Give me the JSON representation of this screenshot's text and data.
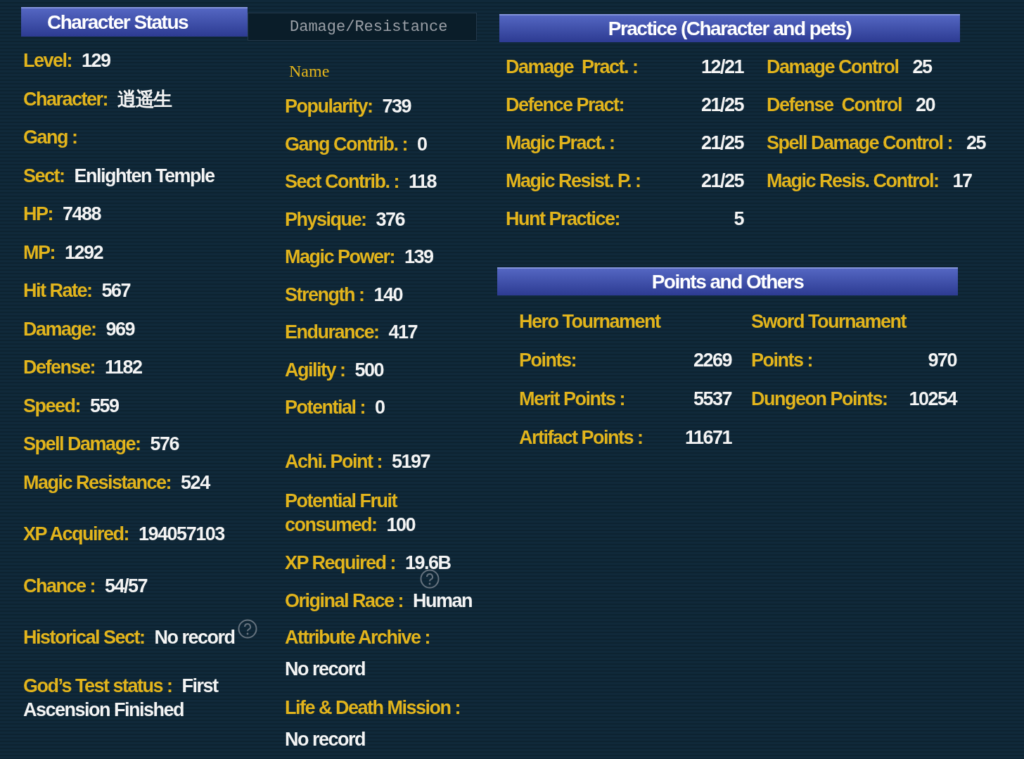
{
  "tabs": [
    {
      "label": "Character Status",
      "selected": true
    },
    {
      "label": "Damage/Resistance",
      "selected": false
    }
  ],
  "character_status": {
    "items": [
      {
        "label": "Level:",
        "value": "129",
        "kind": "inline",
        "help": false
      },
      {
        "label": "Character:",
        "value": "逍遥生",
        "kind": "inline",
        "help": false
      },
      {
        "label": "Gang :",
        "kind": "inline",
        "help": false
      },
      {
        "label": "Sect:",
        "value": "Enlighten Temple",
        "kind": "inline",
        "help": false
      },
      {
        "label": "HP:",
        "value": "7488",
        "kind": "inline",
        "help": false
      },
      {
        "label": "MP:",
        "value": "1292",
        "kind": "inline",
        "help": false
      },
      {
        "label": "Hit Rate:",
        "value": "567",
        "kind": "inline",
        "help": false
      },
      {
        "label": "Damage:",
        "value": "969",
        "kind": "inline",
        "help": false
      },
      {
        "label": "Defense:",
        "value": "1182",
        "kind": "inline",
        "help": false
      },
      {
        "label": "Speed:",
        "value": "559",
        "kind": "inline",
        "help": false
      },
      {
        "label": "Spell Damage:",
        "value": "576",
        "kind": "inline",
        "help": false
      },
      {
        "label": "Magic Resistance:",
        "value": "524",
        "kind": "inline",
        "help": false
      },
      {
        "label": "XP Acquired:",
        "value": "194057103",
        "kind": "inline",
        "help": false
      },
      {
        "label": "Chance :",
        "value": "54/57",
        "kind": "inline",
        "help": false
      },
      {
        "label": "Historical Sect:",
        "value": "No record",
        "kind": "inline",
        "help": true
      },
      {
        "label": "God’s Test status :",
        "value": "First Ascension Finished",
        "kind": "wrapped",
        "help": false
      }
    ]
  },
  "details": {
    "name_label": "Name",
    "items": [
      {
        "label": "Popularity:",
        "value": "739",
        "kind": "inline",
        "help": false
      },
      {
        "label": "Gang Contrib. :",
        "value": "0",
        "kind": "inline",
        "help": false
      },
      {
        "label": "Sect Contrib. :",
        "value": "118",
        "kind": "inline",
        "help": false
      },
      {
        "label": "Physique:",
        "value": "376",
        "kind": "inline",
        "help": false
      },
      {
        "label": "Magic Power:",
        "value": "139",
        "kind": "inline",
        "help": false
      },
      {
        "label": "Strength :",
        "value": "140",
        "kind": "inline",
        "help": false
      },
      {
        "label": "Endurance:",
        "value": "417",
        "kind": "inline",
        "help": false
      },
      {
        "label": "Agility :",
        "value": "500",
        "kind": "inline",
        "help": false
      },
      {
        "label": "Potential :",
        "value": "0",
        "kind": "inline",
        "help": false
      },
      {
        "label": "Achi. Point :",
        "value": "5197",
        "kind": "inline",
        "help": false
      },
      {
        "label": "Potential Fruit consumed:",
        "value": "100",
        "kind": "wrapped",
        "help": false
      },
      {
        "label": "XP Required :",
        "value": "19.6B",
        "kind": "inline",
        "help": true
      },
      {
        "label": "Original Race :",
        "value": "Human",
        "kind": "inline",
        "help": false
      },
      {
        "label": "Attribute Archive :",
        "value": "No record",
        "kind": "stacked",
        "help": false
      },
      {
        "label": "Life & Death Mission :",
        "value": "No record",
        "kind": "stacked",
        "help": false
      }
    ]
  },
  "practice": {
    "title": "Practice (Character and pets)",
    "items": [
      {
        "label": "Damage  Pract. :",
        "value": "12/21"
      },
      {
        "label": "Damage Control",
        "value": "25"
      },
      {
        "label": "Defence Pract:",
        "value": "21/25"
      },
      {
        "label": "Defense  Control",
        "value": "20"
      },
      {
        "label": "Magic Pract. :",
        "value": "21/25"
      },
      {
        "label": "Spell Damage Control :",
        "value": "25"
      },
      {
        "label": "Magic Resist. P. :",
        "value": "21/25"
      },
      {
        "label": "Magic Resis. Control:",
        "value": "17"
      },
      {
        "label": "Hunt Practice:",
        "value": "5"
      }
    ]
  },
  "points": {
    "title": "Points and Others",
    "items": [
      {
        "label": "Hero Tournament Points:",
        "value": "2269"
      },
      {
        "label": "Sword Tournament Points :",
        "value": "970"
      },
      {
        "label": "Merit Points :",
        "value": "5537"
      },
      {
        "label": "Dungeon Points:",
        "value": "10254"
      },
      {
        "label": "Artifact Points :",
        "value": "11671"
      }
    ]
  }
}
